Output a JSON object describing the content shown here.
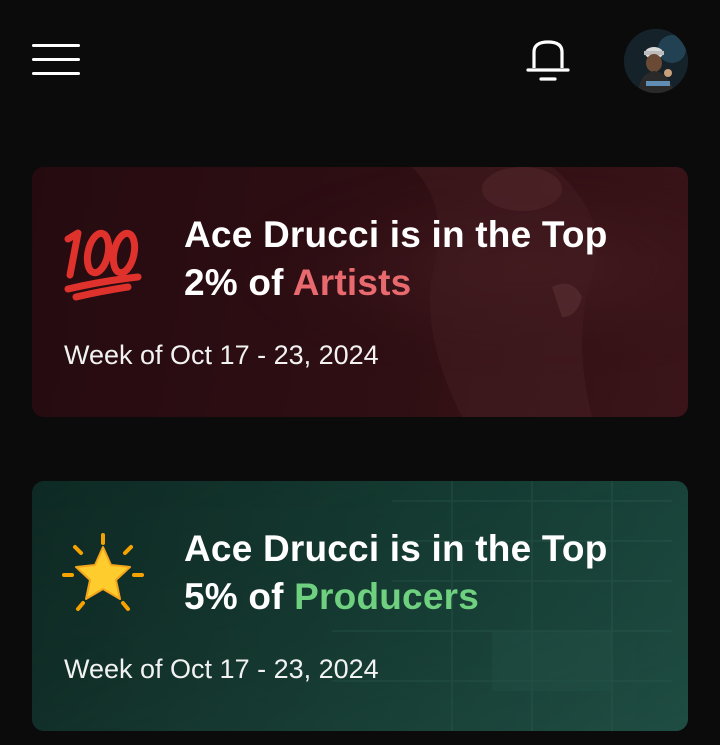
{
  "header": {
    "menu_icon": "hamburger-menu-icon",
    "notification_icon": "bell-icon",
    "avatar_icon": "user-avatar"
  },
  "cards": [
    {
      "emoji_icon": "hundred-points-emoji",
      "title_prefix": "Ace Drucci is in the Top 2% of",
      "highlight": "Artists",
      "highlight_color": "#e86a6f",
      "date": "Week of Oct 17 - 23, 2024",
      "background_color": "#2e0e13"
    },
    {
      "emoji_icon": "glowing-star-emoji",
      "title_prefix": "Ace Drucci is in the Top 5% of",
      "highlight": "Producers",
      "highlight_color": "#6fd07f",
      "date": "Week of Oct 17 - 23, 2024",
      "background_color": "#143a31"
    }
  ]
}
